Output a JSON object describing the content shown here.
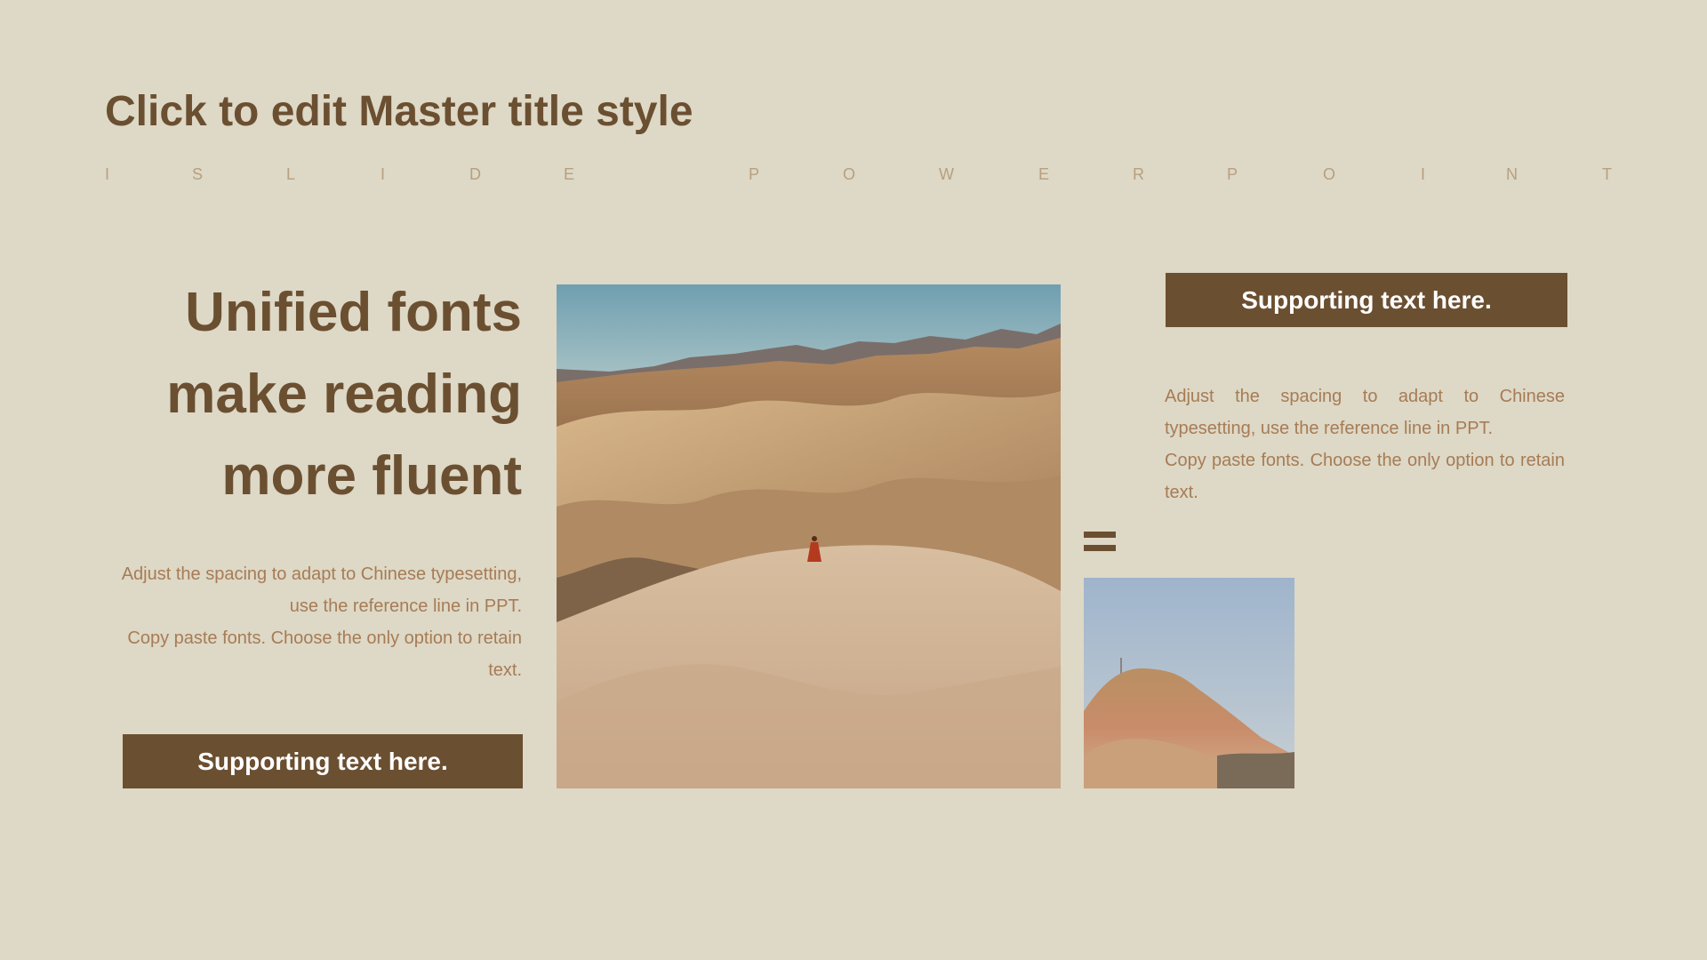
{
  "slide": {
    "master_title": "Click to edit Master title style",
    "spaced_letters": [
      "I",
      "S",
      "L",
      "I",
      "D",
      "E",
      "P",
      "O",
      "W",
      "E",
      "R",
      "P",
      "O",
      "I",
      "N",
      "T"
    ],
    "headline": [
      "Unified fonts",
      "make reading",
      "more fluent"
    ],
    "body_left": [
      "Adjust the spacing to adapt to Chinese typesetting, use the reference line in PPT.",
      "Copy paste  fonts. Choose the only option to retain text."
    ],
    "body_right": [
      "Adjust the spacing to adapt to Chinese typesetting, use the reference line in PPT.",
      "Copy paste  fonts. Choose the only option to retain text."
    ],
    "button_left_label": "Supporting text here.",
    "button_right_label": "Supporting text here.",
    "icons": {
      "divider": "equals-icon"
    },
    "colors": {
      "background": "#ded8c6",
      "accent_brown": "#6b4f31",
      "body_text": "#a67c55",
      "letter_spacing_text": "#b7a080"
    }
  }
}
